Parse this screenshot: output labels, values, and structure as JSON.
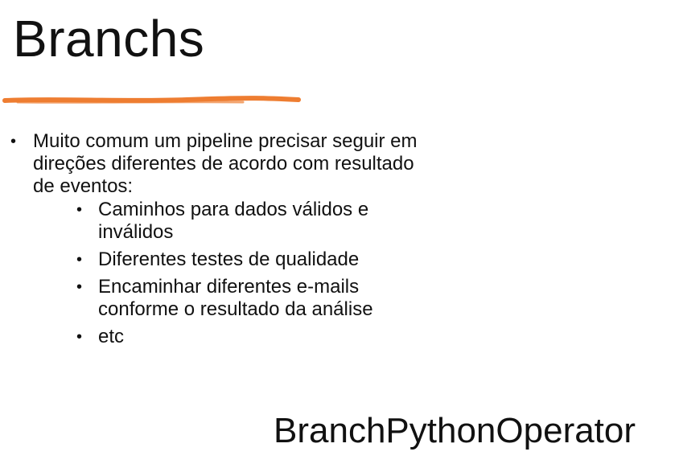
{
  "slide": {
    "title": "Branchs",
    "accent_color": "#ee7d31",
    "bullet_glyph": "•",
    "main_bullet": "Muito comum um pipeline precisar seguir em direções diferentes de acordo com resultado de eventos:",
    "sub_bullets": [
      "Caminhos para dados válidos e inválidos",
      "Diferentes testes de qualidade",
      "Encaminhar diferentes e-mails conforme o resultado da análise",
      "etc"
    ],
    "operator_label": "BranchPythonOperator"
  }
}
